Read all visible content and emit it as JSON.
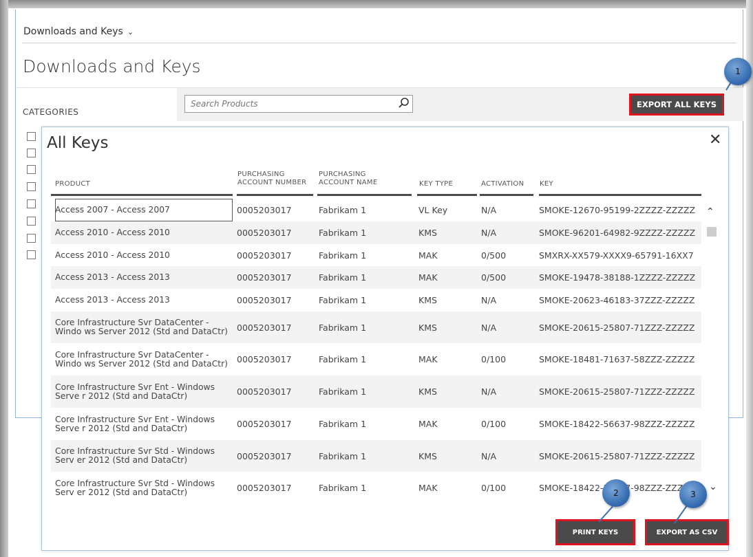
{
  "breadcrumb": {
    "label": "Downloads and Keys"
  },
  "page": {
    "title": "Downloads and Keys",
    "categories_label": "CATEGORIES"
  },
  "search": {
    "placeholder": "Search Products"
  },
  "toolbar": {
    "export_all_label": "EXPORT ALL KEYS"
  },
  "modal": {
    "title": "All Keys",
    "close_glyph": "✕",
    "columns": {
      "product": "PRODUCT",
      "account_number_1": "PURCHASING",
      "account_number_2": "ACCOUNT NUMBER",
      "account_name_1": "PURCHASING",
      "account_name_2": "ACCOUNT NAME",
      "key_type": "KEY TYPE",
      "activation": "ACTIVATION",
      "key": "KEY"
    },
    "rows": [
      {
        "product": "Access 2007 - Access 2007",
        "account_number": "0005203017",
        "account_name": "Fabrikam 1",
        "key_type": "VL Key",
        "activation": "N/A",
        "key": "SMOKE-12670-95199-2ZZZZ-ZZZZZ"
      },
      {
        "product": "Access 2010 - Access 2010",
        "account_number": "0005203017",
        "account_name": "Fabrikam 1",
        "key_type": "KMS",
        "activation": "N/A",
        "key": "SMOKE-96201-64982-9ZZZZ-ZZZZZ"
      },
      {
        "product": "Access 2010 - Access 2010",
        "account_number": "0005203017",
        "account_name": "Fabrikam 1",
        "key_type": "MAK",
        "activation": "0/500",
        "key": "SMXRX-XX579-XXXX9-65791-16XX7"
      },
      {
        "product": "Access 2013 - Access 2013",
        "account_number": "0005203017",
        "account_name": "Fabrikam 1",
        "key_type": "MAK",
        "activation": "0/500",
        "key": "SMOKE-19478-38188-1ZZZZ-ZZZZZ"
      },
      {
        "product": "Access 2013 - Access 2013",
        "account_number": "0005203017",
        "account_name": "Fabrikam 1",
        "key_type": "KMS",
        "activation": "N/A",
        "key": "SMOKE-20623-46183-37ZZZ-ZZZZZ"
      },
      {
        "product": "Core Infrastructure Svr DataCenter - Windo ws Server 2012 (Std and DataCtr)",
        "account_number": "0005203017",
        "account_name": "Fabrikam 1",
        "key_type": "KMS",
        "activation": "N/A",
        "key": "SMOKE-20615-25807-71ZZZ-ZZZZZ"
      },
      {
        "product": "Core Infrastructure Svr DataCenter - Windo ws Server 2012 (Std and DataCtr)",
        "account_number": "0005203017",
        "account_name": "Fabrikam 1",
        "key_type": "MAK",
        "activation": "0/100",
        "key": "SMOKE-18481-71637-58ZZZ-ZZZZZ"
      },
      {
        "product": "Core Infrastructure Svr Ent - Windows Serve r 2012 (Std and DataCtr)",
        "account_number": "0005203017",
        "account_name": "Fabrikam 1",
        "key_type": "KMS",
        "activation": "N/A",
        "key": "SMOKE-20615-25807-71ZZZ-ZZZZZ"
      },
      {
        "product": "Core Infrastructure Svr Ent - Windows Serve r 2012 (Std and DataCtr)",
        "account_number": "0005203017",
        "account_name": "Fabrikam 1",
        "key_type": "MAK",
        "activation": "0/100",
        "key": "SMOKE-18422-56637-98ZZZ-ZZZZZ"
      },
      {
        "product": "Core Infrastructure Svr Std - Windows Serv er 2012 (Std and DataCtr)",
        "account_number": "0005203017",
        "account_name": "Fabrikam 1",
        "key_type": "KMS",
        "activation": "N/A",
        "key": "SMOKE-20615-25807-71ZZZ-ZZZZZ"
      },
      {
        "product": "Core Infrastructure Svr Std - Windows Serv er 2012 (Std and DataCtr)",
        "account_number": "0005203017",
        "account_name": "Fabrikam 1",
        "key_type": "MAK",
        "activation": "0/100",
        "key": "SMOKE-18422-56637-98ZZZ-ZZZZZ"
      }
    ],
    "print_label": "PRINT KEYS",
    "export_csv_label": "EXPORT AS CSV"
  },
  "callouts": {
    "one": "1",
    "two": "2",
    "three": "3"
  },
  "colors": {
    "highlight": "#e0141e",
    "button_bg": "#4a4a4a",
    "callout": "#2f66ad",
    "modal_border": "#a9c3df"
  }
}
